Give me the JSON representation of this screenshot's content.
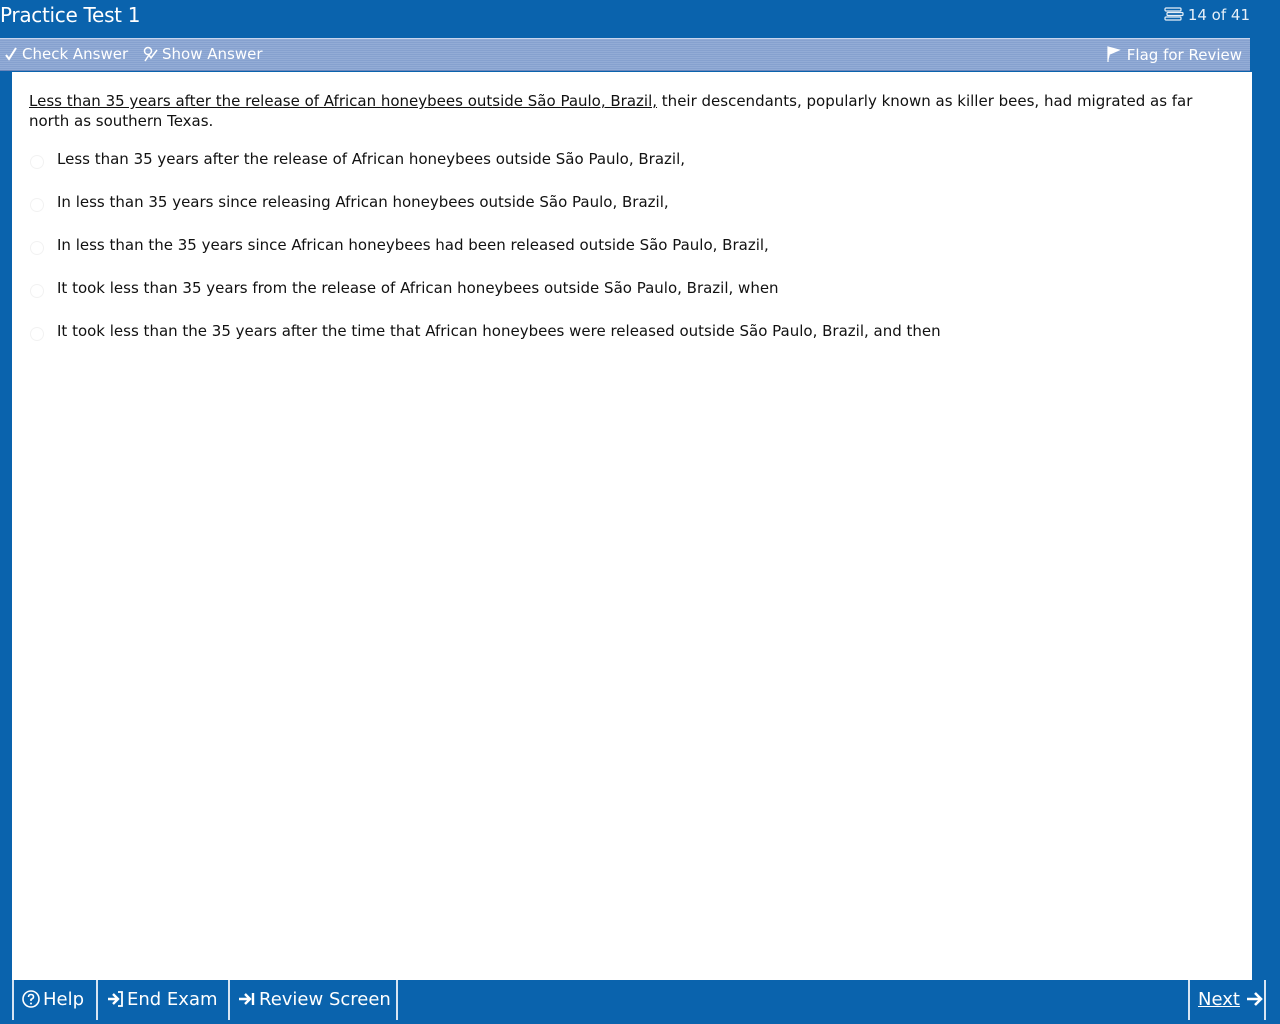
{
  "window": {
    "title": "Practice Test 1",
    "progress": "14 of 41"
  },
  "toolbar": {
    "check_answer": "Check Answer",
    "show_answer": "Show Answer",
    "flag_for_review": "Flag for Review"
  },
  "question": {
    "underlined_text": "Less than 35 years after the release of African honeybees outside São Paulo, Brazil,",
    "rest_text": " their descendants, popularly known as killer bees, had migrated as far north as southern Texas.",
    "choices": [
      "Less than 35 years after the release of African honeybees outside São Paulo, Brazil,",
      "In less than 35 years since releasing African honeybees outside São Paulo, Brazil,",
      "In less than the 35 years since African honeybees had been released outside São Paulo, Brazil,",
      "It took less than 35 years from the release of African honeybees outside São Paulo, Brazil, when",
      "It took less than the 35 years after the time that African honeybees were released outside São Paulo, Brazil, and then"
    ]
  },
  "bottom_bar": {
    "help": "Help",
    "end_exam": "End Exam",
    "review_screen": "Review Screen",
    "next": "Next"
  },
  "colors": {
    "frame_blue": "#0a63ad",
    "toolbar_blue": "#8ca7d3"
  },
  "icons": {
    "progress": "questions-stack-icon",
    "check_answer": "check-pen-icon",
    "show_answer": "show-answer-icon",
    "flag": "flag-icon",
    "help": "question-circle-icon",
    "end_exam": "exit-arrow-icon",
    "review_screen": "arrow-to-bar-icon",
    "next": "right-arrow-icon"
  }
}
